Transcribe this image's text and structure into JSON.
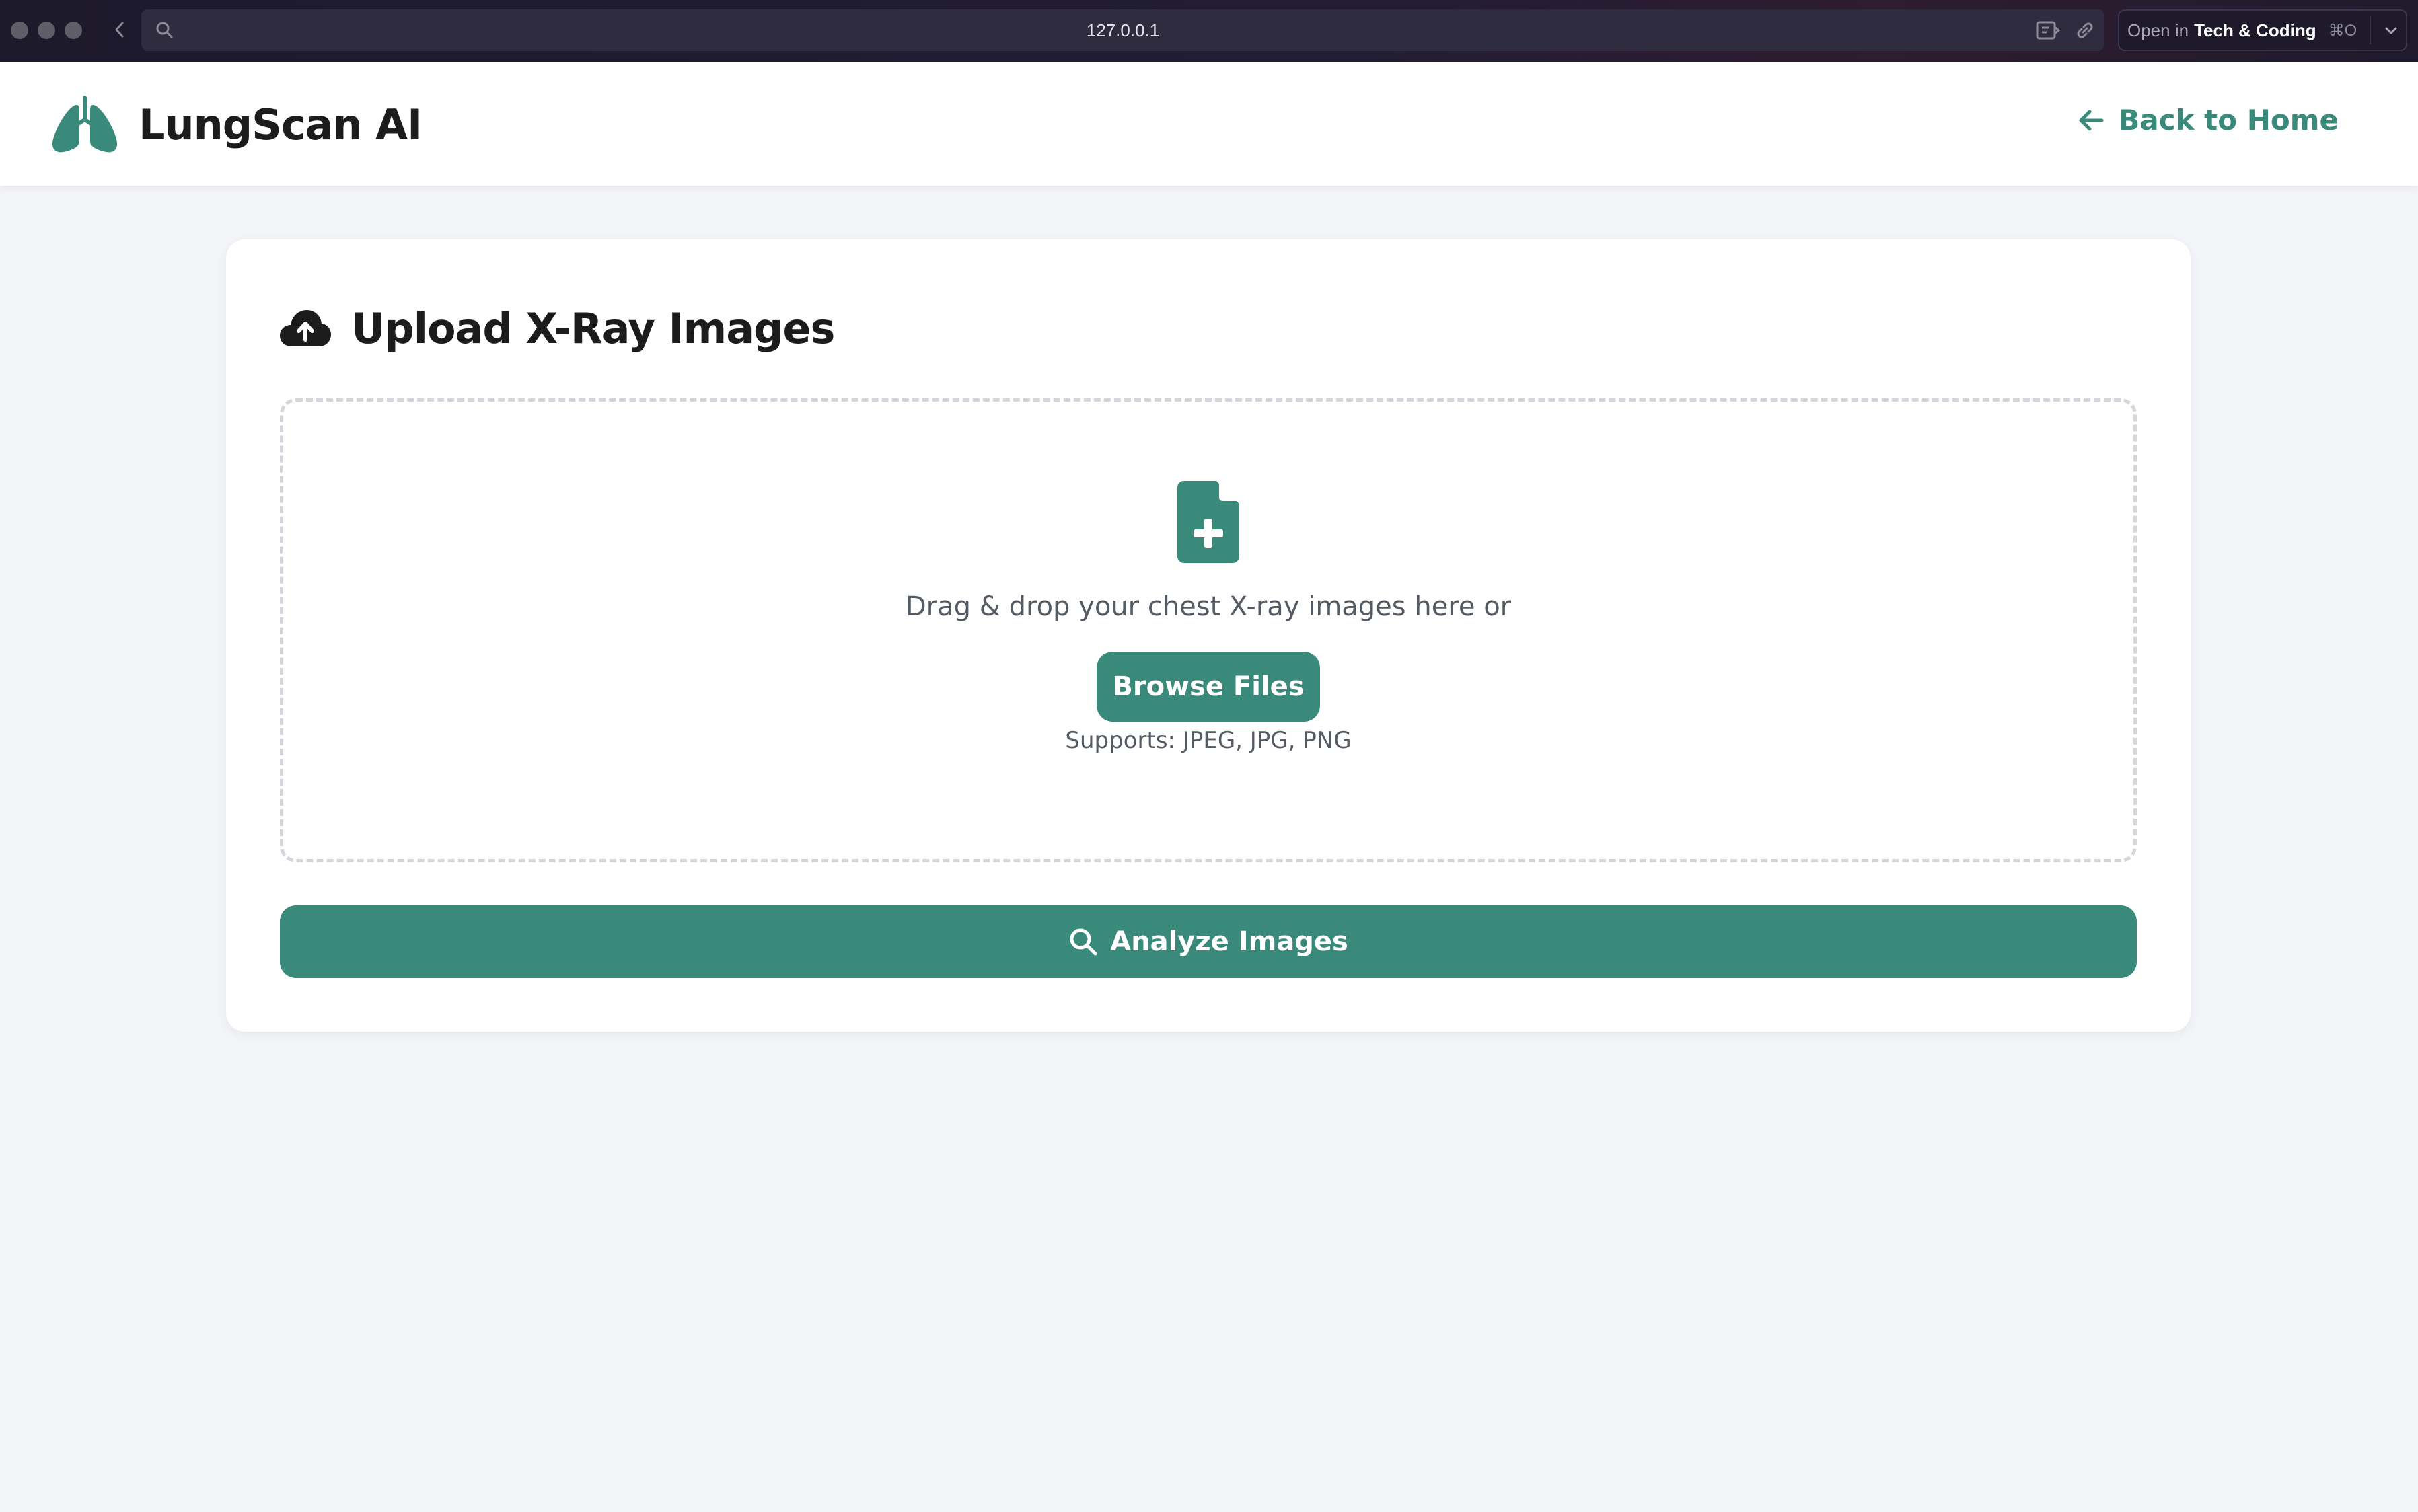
{
  "browser": {
    "url": "127.0.0.1",
    "open_in_prefix": "Open in",
    "open_in_target": "Tech & Coding",
    "open_in_shortcut": "⌘O"
  },
  "header": {
    "brand_name": "LungScan AI",
    "back_link": "Back to Home"
  },
  "upload": {
    "title": "Upload X-Ray Images",
    "drop_text": "Drag & drop your chest X-ray images here or",
    "browse_label": "Browse Files",
    "supports_text": "Supports: JPEG, JPG, PNG",
    "analyze_label": "Analyze Images"
  },
  "colors": {
    "accent": "#3a8a7b",
    "page_bg": "#f4f5f9",
    "text_dark": "#1c1c1c",
    "text_muted": "#555b63"
  },
  "icons": {
    "logo": "lungs-icon",
    "back": "arrow-left-icon",
    "title": "cloud-upload-icon",
    "dropzone": "file-plus-icon",
    "analyze": "search-icon"
  }
}
